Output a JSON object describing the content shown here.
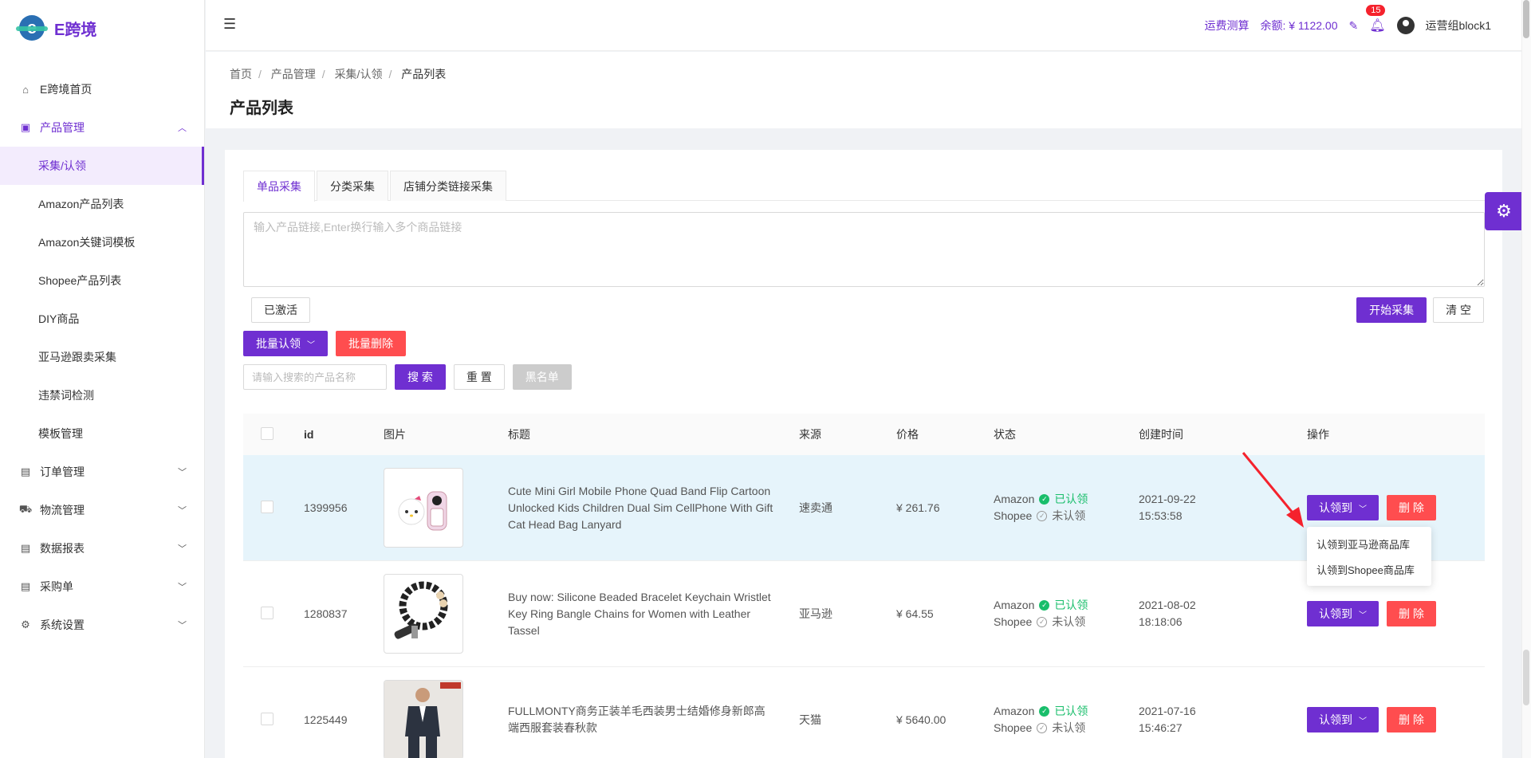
{
  "app": {
    "name": "E跨境",
    "logo_letter": "e"
  },
  "colors": {
    "brand": "#6f2fd1",
    "danger": "#ff4d4f",
    "success": "#19be6b",
    "highlight_row": "#e6f4fb"
  },
  "sidebar": {
    "items": [
      {
        "label": "E跨境首页",
        "icon": "home-icon"
      },
      {
        "label": "产品管理",
        "icon": "product-icon",
        "open": true,
        "children": [
          {
            "label": "采集/认领",
            "active": true
          },
          {
            "label": "Amazon产品列表"
          },
          {
            "label": "Amazon关键词模板"
          },
          {
            "label": "Shopee产品列表"
          },
          {
            "label": "DIY商品"
          },
          {
            "label": "亚马逊跟卖采集"
          },
          {
            "label": "违禁词检测"
          },
          {
            "label": "模板管理"
          }
        ]
      },
      {
        "label": "订单管理",
        "icon": "order-icon"
      },
      {
        "label": "物流管理",
        "icon": "truck-icon"
      },
      {
        "label": "数据报表",
        "icon": "report-icon"
      },
      {
        "label": "采购单",
        "icon": "purchase-icon"
      },
      {
        "label": "系统设置",
        "icon": "gear-icon"
      }
    ]
  },
  "header": {
    "freight_calc": "运费测算",
    "balance": "余额: ¥ 1122.00",
    "notification_count": "15",
    "user": "运营组block1"
  },
  "breadcrumb": [
    "首页",
    "产品管理",
    "采集/认领",
    "产品列表"
  ],
  "page_title": "产品列表",
  "tabs": [
    "单品采集",
    "分类采集",
    "店铺分类链接采集"
  ],
  "link_input": {
    "placeholder": "输入产品链接,Enter换行输入多个商品链接"
  },
  "buttons": {
    "activated": "已激活",
    "start_collect": "开始采集",
    "clear": "清 空",
    "batch_claim": "批量认领",
    "batch_delete": "批量删除",
    "search": "搜 索",
    "reset": "重 置",
    "blacklist": "黑名单"
  },
  "search": {
    "placeholder": "请输入搜索的产品名称"
  },
  "table": {
    "headers": {
      "id": "id",
      "image": "图片",
      "title": "标题",
      "source": "来源",
      "price": "价格",
      "status": "状态",
      "created": "创建时间",
      "actions": "操作"
    },
    "rows": [
      {
        "id": "1399956",
        "title": "Cute Mini Girl Mobile Phone Quad Band Flip Cartoon Unlocked Kids Children Dual Sim CellPhone With Gift Cat Head Bag Lanyard",
        "source": "速卖通",
        "price": "¥ 261.76",
        "status_amazon_platform": "Amazon",
        "status_amazon": "已认领",
        "status_shopee_platform": "Shopee",
        "status_shopee": "未认领",
        "date": "2021-09-22",
        "time": "15:53:58",
        "claim": "认领到",
        "delete": "删 除",
        "image": "phone-image"
      },
      {
        "id": "1280837",
        "title": "Buy now: Silicone Beaded Bracelet Keychain Wristlet Key Ring Bangle Chains for Women with Leather Tassel",
        "source": "亚马逊",
        "price": "¥ 64.55",
        "status_amazon_platform": "Amazon",
        "status_amazon": "已认领",
        "status_shopee_platform": "Shopee",
        "status_shopee": "未认领",
        "date": "2021-08-02",
        "time": "18:18:06",
        "claim": "认领到",
        "delete": "删 除",
        "image": "bracelet-image"
      },
      {
        "id": "1225449",
        "title": "FULLMONTY商务正装羊毛西装男士结婚修身新郎高端西服套装春秋款",
        "source": "天猫",
        "price": "¥ 5640.00",
        "status_amazon_platform": "Amazon",
        "status_amazon": "已认领",
        "status_shopee_platform": "Shopee",
        "status_shopee": "未认领",
        "date": "2021-07-16",
        "time": "15:46:27",
        "claim": "认领到",
        "delete": "删 除",
        "image": "suit-image"
      }
    ]
  },
  "claim_dropdown": [
    "认领到亚马逊商品库",
    "认领到Shopee商品库"
  ]
}
